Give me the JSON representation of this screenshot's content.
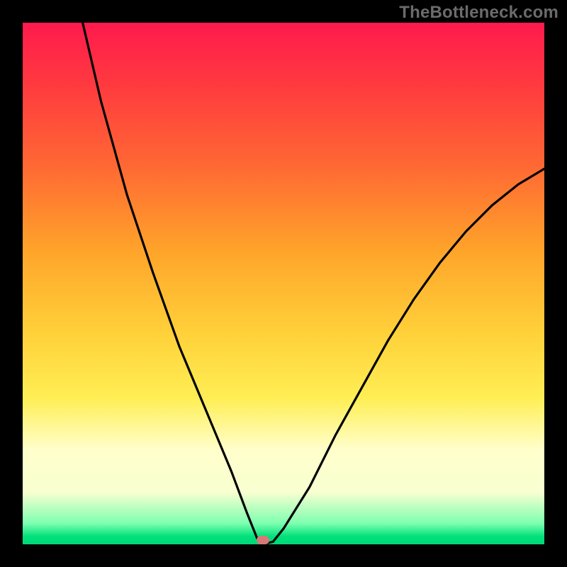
{
  "watermark": "TheBottleneck.com",
  "colors": {
    "frameBorder": "#000000",
    "gradientTop": "#ff1a4d",
    "gradientBottom": "#00d97a",
    "curveStroke": "#000000",
    "marker": "#d87878"
  },
  "chart_data": {
    "type": "line",
    "title": "",
    "xlabel": "",
    "ylabel": "",
    "xlim": [
      0,
      100
    ],
    "ylim": [
      0,
      100
    ],
    "grid": false,
    "legend": false,
    "annotations": [
      "TheBottleneck.com"
    ],
    "background": "vertical-gradient red→orange→yellow→pale→green",
    "series": [
      {
        "name": "bottleneck-curve",
        "description": "V-shaped curve; steep descent from top-left to a minimum near x≈46 at y≈0, then rises to x=100 y≈72",
        "x": [
          11.5,
          15,
          20,
          25,
          30,
          35,
          40,
          43,
          45,
          46,
          48,
          50,
          55,
          60,
          65,
          70,
          75,
          80,
          85,
          90,
          95,
          100
        ],
        "y": [
          100,
          85,
          67,
          52,
          38,
          26,
          14,
          6,
          1,
          0,
          0.5,
          3,
          11,
          21,
          30,
          39,
          47,
          54,
          60,
          65,
          69,
          72
        ]
      }
    ],
    "marker": {
      "x_pct": 46,
      "y_pct": 0,
      "color": "#d87878",
      "shape": "pill"
    }
  }
}
